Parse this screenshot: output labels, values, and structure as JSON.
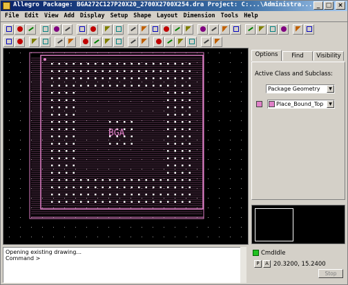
{
  "window": {
    "title": "Allegro Package: BGA272C127P20X20_2700X2700X254.dra  Project: C:...\\Administra...",
    "controls": [
      "_",
      "□",
      "×"
    ]
  },
  "menu": [
    "File",
    "Edit",
    "View",
    "Add",
    "Display",
    "Setup",
    "Shape",
    "Layout",
    "Dimension",
    "Tools",
    "Help"
  ],
  "toolbar_icons": {
    "row1": [
      "new-icon",
      "open-icon",
      "save-icon",
      "sep",
      "move-icon",
      "copy-icon",
      "delete-icon",
      "sep",
      "undo-icon",
      "redo-icon",
      "sep",
      "pick-icon",
      "refresh-icon",
      "sep",
      "zoom-points-icon",
      "zoom-fit-icon",
      "zoom-in-icon",
      "zoom-out-icon",
      "zoom-world-icon",
      "3d-icon",
      "sep",
      "line-icon",
      "rect-icon",
      "circle-icon",
      "arc-icon",
      "sep",
      "grid-icon",
      "info-icon",
      "layers-icon",
      "color-icon",
      "sep",
      "hash-icon",
      "props-icon"
    ],
    "row2": [
      "route-icon",
      "slide-icon",
      "sep",
      "cline-icon",
      "via-icon",
      "sep",
      "shape-icon",
      "void-icon",
      "sep",
      "dim-icon",
      "text-icon",
      "label-icon",
      "refdes-icon",
      "sep",
      "snap-icon",
      "align-icon",
      "sep",
      "measure-icon",
      "spacing-icon",
      "angle-icon",
      "curve-icon",
      "sep",
      "fillet-icon",
      "chamfer-icon"
    ]
  },
  "canvas": {
    "component_label": "BGA",
    "colors": {
      "background": "#000000",
      "geometry": "#e080c8",
      "grid": "#c0c0c0"
    }
  },
  "panel": {
    "tabs": [
      "Options",
      "Find",
      "Visibility"
    ],
    "active_tab": "Options",
    "active_class_label": "Active Class and Subclass:",
    "class_value": "Package Geometry",
    "subclass_value": "Place_Bound_Top",
    "subclass_color": "#e080c8"
  },
  "console": {
    "lines": [
      "Opening existing drawing...",
      "Command >"
    ]
  },
  "status": {
    "cmd_label": "Cmd:",
    "state": "Idle",
    "p_label": "P",
    "a_label": "A",
    "coords": "20.3200, 15.2400",
    "stop_label": "Stop"
  }
}
